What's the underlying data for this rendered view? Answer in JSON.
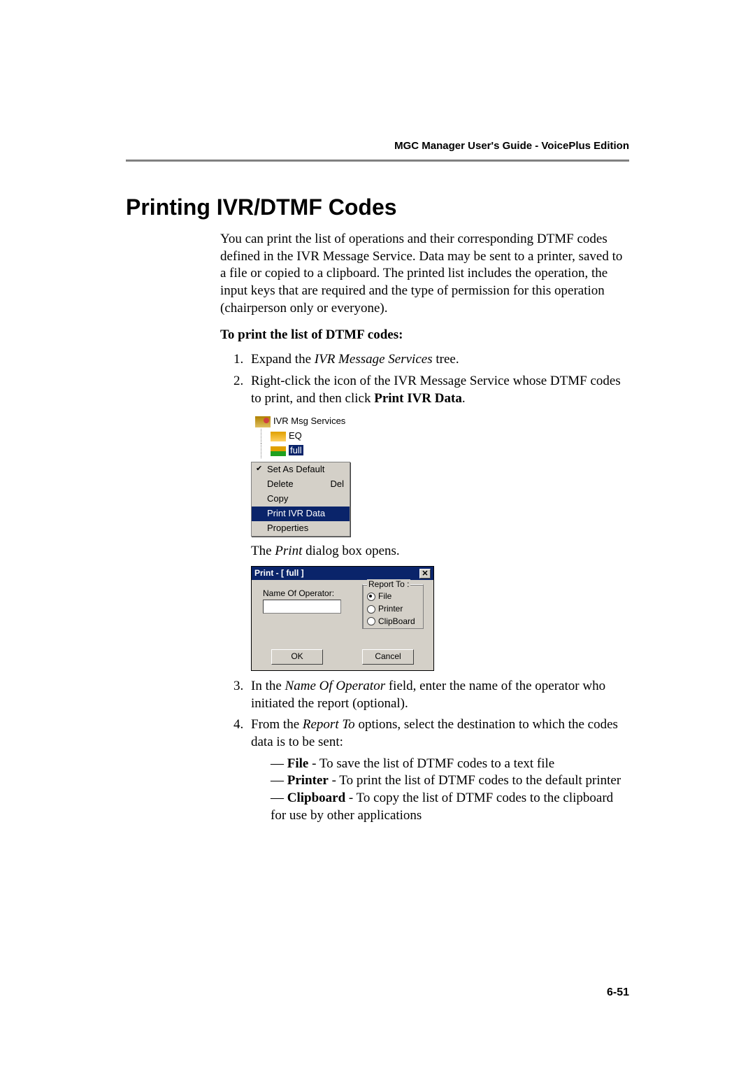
{
  "running_header": "MGC Manager User's Guide - VoicePlus Edition",
  "heading": "Printing IVR/DTMF Codes",
  "intro": "You can print the list of operations and their corresponding DTMF codes defined in the IVR Message Service. Data may be sent to a printer, saved to a file or copied to a clipboard. The printed list includes the operation, the input keys that are required and the type of permission for this operation (chairperson only or everyone).",
  "subhead": "To print the list of DTMF codes:",
  "step1_pre": "Expand the ",
  "step1_em": "IVR Message Services",
  "step1_post": " tree.",
  "step2_pre": "Right-click the icon of the IVR Message Service whose DTMF codes to print, and then click ",
  "step2_bold": "Print IVR Data",
  "step2_post": ".",
  "tree_root": "IVR Msg Services",
  "tree_item1": "EQ",
  "tree_item2": "full",
  "menu": {
    "set_default": "Set As Default",
    "delete": "Delete",
    "delete_accel": "Del",
    "copy": "Copy",
    "print_ivr": "Print IVR Data",
    "properties": "Properties"
  },
  "after_tree_pre": "The ",
  "after_tree_em": "Print",
  "after_tree_post": " dialog box opens.",
  "dialog": {
    "title": "Print - [ full ]",
    "name_label": "Name Of Operator:",
    "group_label": "Report To :",
    "opt_file": "File",
    "opt_printer": "Printer",
    "opt_clipboard": "ClipBoard",
    "ok": "OK",
    "cancel": "Cancel"
  },
  "step3_pre": "In the ",
  "step3_em": "Name Of Operator",
  "step3_post": " field, enter the name of the operator who initiated the report (optional).",
  "step4_pre": "From the ",
  "step4_em": "Report To",
  "step4_post": " options, select the destination to which the codes data is to be sent:",
  "bullet_file_b": "File",
  "bullet_file_t": " - To save the list of DTMF codes to a text file",
  "bullet_printer_b": "Printer",
  "bullet_printer_t": " - To print the list of DTMF codes to the default printer",
  "bullet_clip_b": "Clipboard",
  "bullet_clip_t": " - To copy the list of DTMF codes to the clipboard for use by other applications",
  "page_number": "6-51"
}
